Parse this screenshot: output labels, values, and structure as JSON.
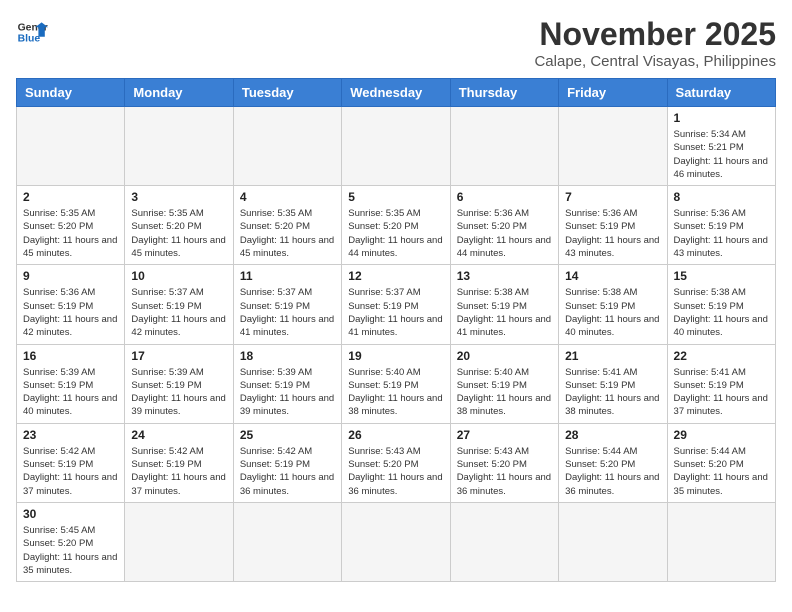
{
  "header": {
    "logo_general": "General",
    "logo_blue": "Blue",
    "month_title": "November 2025",
    "location": "Calape, Central Visayas, Philippines"
  },
  "weekdays": [
    "Sunday",
    "Monday",
    "Tuesday",
    "Wednesday",
    "Thursday",
    "Friday",
    "Saturday"
  ],
  "weeks": [
    [
      {
        "day": "",
        "sunrise": "",
        "sunset": "",
        "daylight": ""
      },
      {
        "day": "",
        "sunrise": "",
        "sunset": "",
        "daylight": ""
      },
      {
        "day": "",
        "sunrise": "",
        "sunset": "",
        "daylight": ""
      },
      {
        "day": "",
        "sunrise": "",
        "sunset": "",
        "daylight": ""
      },
      {
        "day": "",
        "sunrise": "",
        "sunset": "",
        "daylight": ""
      },
      {
        "day": "",
        "sunrise": "",
        "sunset": "",
        "daylight": ""
      },
      {
        "day": "1",
        "sunrise": "Sunrise: 5:34 AM",
        "sunset": "Sunset: 5:21 PM",
        "daylight": "Daylight: 11 hours and 46 minutes."
      }
    ],
    [
      {
        "day": "2",
        "sunrise": "Sunrise: 5:35 AM",
        "sunset": "Sunset: 5:20 PM",
        "daylight": "Daylight: 11 hours and 45 minutes."
      },
      {
        "day": "3",
        "sunrise": "Sunrise: 5:35 AM",
        "sunset": "Sunset: 5:20 PM",
        "daylight": "Daylight: 11 hours and 45 minutes."
      },
      {
        "day": "4",
        "sunrise": "Sunrise: 5:35 AM",
        "sunset": "Sunset: 5:20 PM",
        "daylight": "Daylight: 11 hours and 45 minutes."
      },
      {
        "day": "5",
        "sunrise": "Sunrise: 5:35 AM",
        "sunset": "Sunset: 5:20 PM",
        "daylight": "Daylight: 11 hours and 44 minutes."
      },
      {
        "day": "6",
        "sunrise": "Sunrise: 5:36 AM",
        "sunset": "Sunset: 5:20 PM",
        "daylight": "Daylight: 11 hours and 44 minutes."
      },
      {
        "day": "7",
        "sunrise": "Sunrise: 5:36 AM",
        "sunset": "Sunset: 5:19 PM",
        "daylight": "Daylight: 11 hours and 43 minutes."
      },
      {
        "day": "8",
        "sunrise": "Sunrise: 5:36 AM",
        "sunset": "Sunset: 5:19 PM",
        "daylight": "Daylight: 11 hours and 43 minutes."
      }
    ],
    [
      {
        "day": "9",
        "sunrise": "Sunrise: 5:36 AM",
        "sunset": "Sunset: 5:19 PM",
        "daylight": "Daylight: 11 hours and 42 minutes."
      },
      {
        "day": "10",
        "sunrise": "Sunrise: 5:37 AM",
        "sunset": "Sunset: 5:19 PM",
        "daylight": "Daylight: 11 hours and 42 minutes."
      },
      {
        "day": "11",
        "sunrise": "Sunrise: 5:37 AM",
        "sunset": "Sunset: 5:19 PM",
        "daylight": "Daylight: 11 hours and 41 minutes."
      },
      {
        "day": "12",
        "sunrise": "Sunrise: 5:37 AM",
        "sunset": "Sunset: 5:19 PM",
        "daylight": "Daylight: 11 hours and 41 minutes."
      },
      {
        "day": "13",
        "sunrise": "Sunrise: 5:38 AM",
        "sunset": "Sunset: 5:19 PM",
        "daylight": "Daylight: 11 hours and 41 minutes."
      },
      {
        "day": "14",
        "sunrise": "Sunrise: 5:38 AM",
        "sunset": "Sunset: 5:19 PM",
        "daylight": "Daylight: 11 hours and 40 minutes."
      },
      {
        "day": "15",
        "sunrise": "Sunrise: 5:38 AM",
        "sunset": "Sunset: 5:19 PM",
        "daylight": "Daylight: 11 hours and 40 minutes."
      }
    ],
    [
      {
        "day": "16",
        "sunrise": "Sunrise: 5:39 AM",
        "sunset": "Sunset: 5:19 PM",
        "daylight": "Daylight: 11 hours and 40 minutes."
      },
      {
        "day": "17",
        "sunrise": "Sunrise: 5:39 AM",
        "sunset": "Sunset: 5:19 PM",
        "daylight": "Daylight: 11 hours and 39 minutes."
      },
      {
        "day": "18",
        "sunrise": "Sunrise: 5:39 AM",
        "sunset": "Sunset: 5:19 PM",
        "daylight": "Daylight: 11 hours and 39 minutes."
      },
      {
        "day": "19",
        "sunrise": "Sunrise: 5:40 AM",
        "sunset": "Sunset: 5:19 PM",
        "daylight": "Daylight: 11 hours and 38 minutes."
      },
      {
        "day": "20",
        "sunrise": "Sunrise: 5:40 AM",
        "sunset": "Sunset: 5:19 PM",
        "daylight": "Daylight: 11 hours and 38 minutes."
      },
      {
        "day": "21",
        "sunrise": "Sunrise: 5:41 AM",
        "sunset": "Sunset: 5:19 PM",
        "daylight": "Daylight: 11 hours and 38 minutes."
      },
      {
        "day": "22",
        "sunrise": "Sunrise: 5:41 AM",
        "sunset": "Sunset: 5:19 PM",
        "daylight": "Daylight: 11 hours and 37 minutes."
      }
    ],
    [
      {
        "day": "23",
        "sunrise": "Sunrise: 5:42 AM",
        "sunset": "Sunset: 5:19 PM",
        "daylight": "Daylight: 11 hours and 37 minutes."
      },
      {
        "day": "24",
        "sunrise": "Sunrise: 5:42 AM",
        "sunset": "Sunset: 5:19 PM",
        "daylight": "Daylight: 11 hours and 37 minutes."
      },
      {
        "day": "25",
        "sunrise": "Sunrise: 5:42 AM",
        "sunset": "Sunset: 5:19 PM",
        "daylight": "Daylight: 11 hours and 36 minutes."
      },
      {
        "day": "26",
        "sunrise": "Sunrise: 5:43 AM",
        "sunset": "Sunset: 5:20 PM",
        "daylight": "Daylight: 11 hours and 36 minutes."
      },
      {
        "day": "27",
        "sunrise": "Sunrise: 5:43 AM",
        "sunset": "Sunset: 5:20 PM",
        "daylight": "Daylight: 11 hours and 36 minutes."
      },
      {
        "day": "28",
        "sunrise": "Sunrise: 5:44 AM",
        "sunset": "Sunset: 5:20 PM",
        "daylight": "Daylight: 11 hours and 36 minutes."
      },
      {
        "day": "29",
        "sunrise": "Sunrise: 5:44 AM",
        "sunset": "Sunset: 5:20 PM",
        "daylight": "Daylight: 11 hours and 35 minutes."
      }
    ],
    [
      {
        "day": "30",
        "sunrise": "Sunrise: 5:45 AM",
        "sunset": "Sunset: 5:20 PM",
        "daylight": "Daylight: 11 hours and 35 minutes."
      },
      {
        "day": "",
        "sunrise": "",
        "sunset": "",
        "daylight": ""
      },
      {
        "day": "",
        "sunrise": "",
        "sunset": "",
        "daylight": ""
      },
      {
        "day": "",
        "sunrise": "",
        "sunset": "",
        "daylight": ""
      },
      {
        "day": "",
        "sunrise": "",
        "sunset": "",
        "daylight": ""
      },
      {
        "day": "",
        "sunrise": "",
        "sunset": "",
        "daylight": ""
      },
      {
        "day": "",
        "sunrise": "",
        "sunset": "",
        "daylight": ""
      }
    ]
  ]
}
